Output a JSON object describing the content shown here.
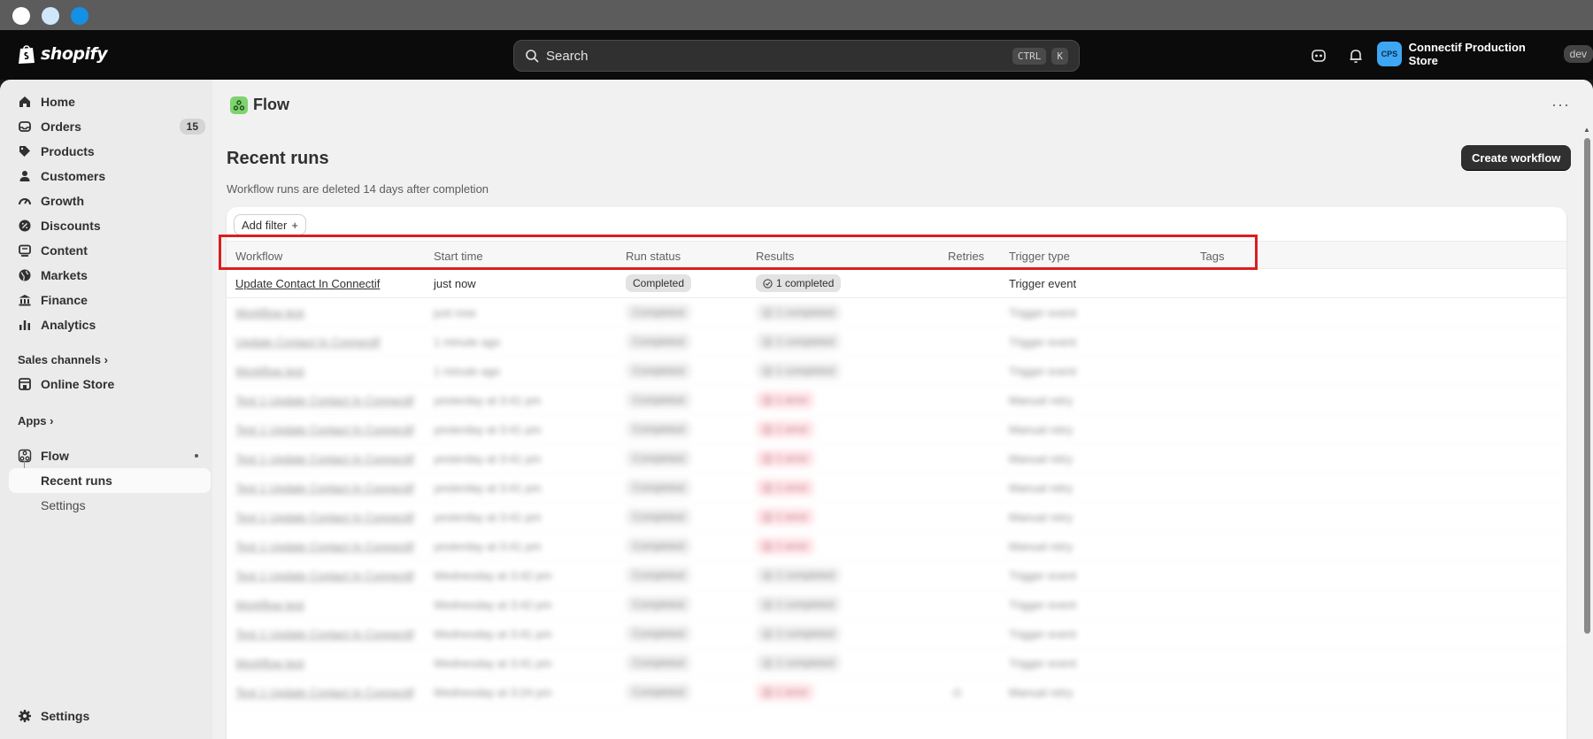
{
  "topbar": {
    "brand": "shopify",
    "search_placeholder": "Search",
    "shortcut": [
      "CTRL",
      "K"
    ],
    "store_initials": "CPS",
    "store_name": "Connectif Production Store",
    "store_badge": "dev"
  },
  "sidebar": {
    "items": [
      {
        "label": "Home",
        "icon": "home-icon"
      },
      {
        "label": "Orders",
        "icon": "orders-icon",
        "badge": "15"
      },
      {
        "label": "Products",
        "icon": "tag-icon"
      },
      {
        "label": "Customers",
        "icon": "person-icon"
      },
      {
        "label": "Growth",
        "icon": "gauge-icon"
      },
      {
        "label": "Discounts",
        "icon": "discount-icon"
      },
      {
        "label": "Content",
        "icon": "content-icon"
      },
      {
        "label": "Markets",
        "icon": "globe-icon"
      },
      {
        "label": "Finance",
        "icon": "bank-icon"
      },
      {
        "label": "Analytics",
        "icon": "chart-icon"
      }
    ],
    "sales_channels_label": "Sales channels",
    "online_store": "Online Store",
    "apps_label": "Apps",
    "flow": "Flow",
    "recent_runs": "Recent runs",
    "flow_settings": "Settings",
    "settings": "Settings"
  },
  "page": {
    "app_name": "Flow",
    "title": "Recent runs",
    "create_button": "Create workflow",
    "note": "Workflow runs are deleted 14 days after completion",
    "add_filter": "Add filter"
  },
  "table": {
    "headers": [
      "Workflow",
      "Start time",
      "Run status",
      "Results",
      "Retries",
      "Trigger type",
      "Tags"
    ],
    "rows": [
      {
        "workflow": "Update Contact In Connectif",
        "start": "just now",
        "status": "Completed",
        "result": "1 completed",
        "result_type": "ok",
        "retries": "",
        "trigger": "Trigger event"
      },
      {
        "workflow": "Workflow test",
        "start": "just now",
        "status": "Completed",
        "result": "1 completed",
        "result_type": "ok",
        "retries": "",
        "trigger": "Trigger event"
      },
      {
        "workflow": "Update Contact In Connectif",
        "start": "1 minute ago",
        "status": "Completed",
        "result": "1 completed",
        "result_type": "ok",
        "retries": "",
        "trigger": "Trigger event"
      },
      {
        "workflow": "Workflow test",
        "start": "1 minute ago",
        "status": "Completed",
        "result": "1 completed",
        "result_type": "ok",
        "retries": "",
        "trigger": "Trigger event"
      },
      {
        "workflow": "Test 1 Update Contact In Connectif",
        "start": "yesterday at 3:41 pm",
        "status": "Completed",
        "result": "1 error",
        "result_type": "error",
        "retries": "",
        "trigger": "Manual retry"
      },
      {
        "workflow": "Test 1 Update Contact In Connectif",
        "start": "yesterday at 3:41 pm",
        "status": "Completed",
        "result": "1 error",
        "result_type": "error",
        "retries": "",
        "trigger": "Manual retry"
      },
      {
        "workflow": "Test 1 Update Contact In Connectif",
        "start": "yesterday at 3:41 pm",
        "status": "Completed",
        "result": "1 error",
        "result_type": "error",
        "retries": "",
        "trigger": "Manual retry"
      },
      {
        "workflow": "Test 1 Update Contact In Connectif",
        "start": "yesterday at 3:41 pm",
        "status": "Completed",
        "result": "1 error",
        "result_type": "error",
        "retries": "",
        "trigger": "Manual retry"
      },
      {
        "workflow": "Test 1 Update Contact In Connectif",
        "start": "yesterday at 3:41 pm",
        "status": "Completed",
        "result": "1 error",
        "result_type": "error",
        "retries": "",
        "trigger": "Manual retry"
      },
      {
        "workflow": "Test 1 Update Contact In Connectif",
        "start": "yesterday at 3:41 pm",
        "status": "Completed",
        "result": "1 error",
        "result_type": "error",
        "retries": "",
        "trigger": "Manual retry"
      },
      {
        "workflow": "Test 1 Update Contact In Connectif",
        "start": "Wednesday at 3:42 pm",
        "status": "Completed",
        "result": "1 completed",
        "result_type": "ok",
        "retries": "",
        "trigger": "Trigger event"
      },
      {
        "workflow": "Workflow test",
        "start": "Wednesday at 3:42 pm",
        "status": "Completed",
        "result": "1 completed",
        "result_type": "ok",
        "retries": "",
        "trigger": "Trigger event"
      },
      {
        "workflow": "Test 1 Update Contact In Connectif",
        "start": "Wednesday at 3:41 pm",
        "status": "Completed",
        "result": "1 completed",
        "result_type": "ok",
        "retries": "",
        "trigger": "Trigger event"
      },
      {
        "workflow": "Workflow test",
        "start": "Wednesday at 3:41 pm",
        "status": "Completed",
        "result": "1 completed",
        "result_type": "ok",
        "retries": "",
        "trigger": "Trigger event"
      },
      {
        "workflow": "Test 1 Update Contact In Connectif",
        "start": "Wednesday at 3:24 pm",
        "status": "Completed",
        "result": "1 error",
        "result_type": "error",
        "retries": "⊙",
        "trigger": "Manual retry"
      }
    ]
  },
  "colors": {
    "accent_dark": "#303030",
    "highlight": "#d91f1f",
    "error_bg": "#fed1d7",
    "app_icon": "#7fd36f"
  }
}
